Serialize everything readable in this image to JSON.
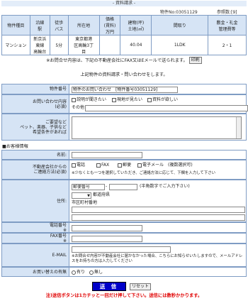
{
  "header": {
    "title": "- 資料請求 -"
  },
  "meta": {
    "property_no": "物件No:03051129",
    "ref_count": "参照数:[9]"
  },
  "property_table": {
    "headers": [
      "物件種目",
      "沿線\n駅",
      "徒歩\nバス",
      "所在地",
      "価格\n(賃料)\n万円",
      "建物(坪)\n土地(㎡)",
      "間取り",
      "敷金・礼金\n管理費等"
    ],
    "row": [
      "マンション",
      "新京浜\n東線\n高輪台",
      "5分",
      "東京都港\n区高輪3丁\n目",
      "",
      "40.04",
      "1LDK",
      "2・1"
    ]
  },
  "notice": {
    "text": "※お問合せ内容は、下記の不動産会社にFAX又はEメールで送られます。",
    "print_label": "印刷"
  },
  "intro": "上記物件の資料請求・問い合わせをします。",
  "form": {
    "property_no_label": "物件番号",
    "property_no_value": "物件のお問い合わせ　[物件番号03051129]",
    "inquiry_label": "お問い合わせ内容",
    "inquiry_required": "(必須)",
    "inquiry_options": [
      "説明が聞きたい",
      "現地が見たい",
      "資料が欲しい"
    ],
    "other_label": "その他",
    "request_label": "ご要望など\nペット、楽器、子供など\n希望条件があれば",
    "section_title": "■お客様情報",
    "name_label": "名前:",
    "contact_label": "不動産会社からの\nご連絡方法(必須)",
    "contact_options": [
      "電話",
      "FAX",
      "郵便",
      "電子メール　(複数選択可)"
    ],
    "contact_note": "※少なくとも一つを選択していただき、ご連絡方法に応じて、下欄を入力して下さい",
    "address_label": "住所:",
    "postal_label": "郵便番号",
    "postal_note": "(半角数字でご入力下さい)",
    "pref_label": "都道府県",
    "city_label": "市区町村番地",
    "phone_label": "電話番号",
    "fax_label": "FAX番号",
    "email_label": "E-MAIL",
    "email_note": "※お問合せ内容が不動産会社に届かなかった場合、こちらにお知らせいたしますので、メールアドレスをお持ちの方は入力してください",
    "asterisk": "※",
    "purchase_label": "お買い替えの有無",
    "purchase_options": [
      "有り",
      "無し"
    ]
  },
  "buttons": {
    "submit": "送 信",
    "reset": "リセット"
  },
  "warning": "注)送信ボタンは1カチッと一回だけ押して下さい。送信には数秒かかります。"
}
